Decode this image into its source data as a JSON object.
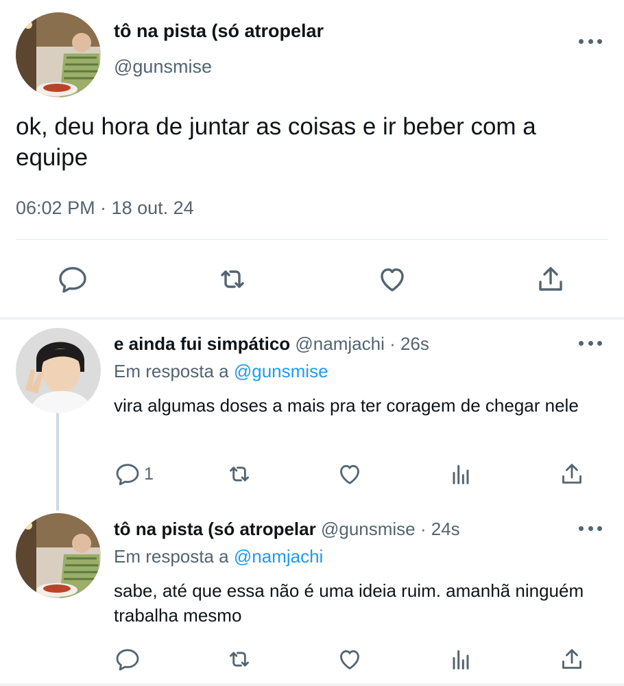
{
  "main_tweet": {
    "name": "tô na pista (só atropelar",
    "handle": "@gunsmise",
    "text": "ok, deu hora de juntar as coisas e ir beber com a equipe",
    "timestamp": "06:02 PM · 18 out. 24",
    "actions": [
      "reply-icon",
      "retweet-icon",
      "like-icon",
      "share-icon"
    ]
  },
  "replies": [
    {
      "name": "e ainda fui simpático",
      "meta": "@namjachi · 26s",
      "reply_prefix": "Em resposta a ",
      "reply_to": "@gunsmise",
      "text": "vira algumas doses a mais pra ter coragem de chegar nele",
      "reply_count": "1"
    },
    {
      "name": "tô na pista (só atropelar",
      "meta": "@gunsmise · 24s",
      "reply_prefix": "Em resposta a ",
      "reply_to": "@namjachi",
      "text": "sabe, até que essa não é uma ideia ruim. amanhã ninguém trabalha mesmo",
      "reply_count": ""
    }
  ],
  "colors": {
    "text": "#0f1419",
    "secondary": "#536471",
    "link": "#1d9bf0",
    "divider": "#eff3f4"
  }
}
